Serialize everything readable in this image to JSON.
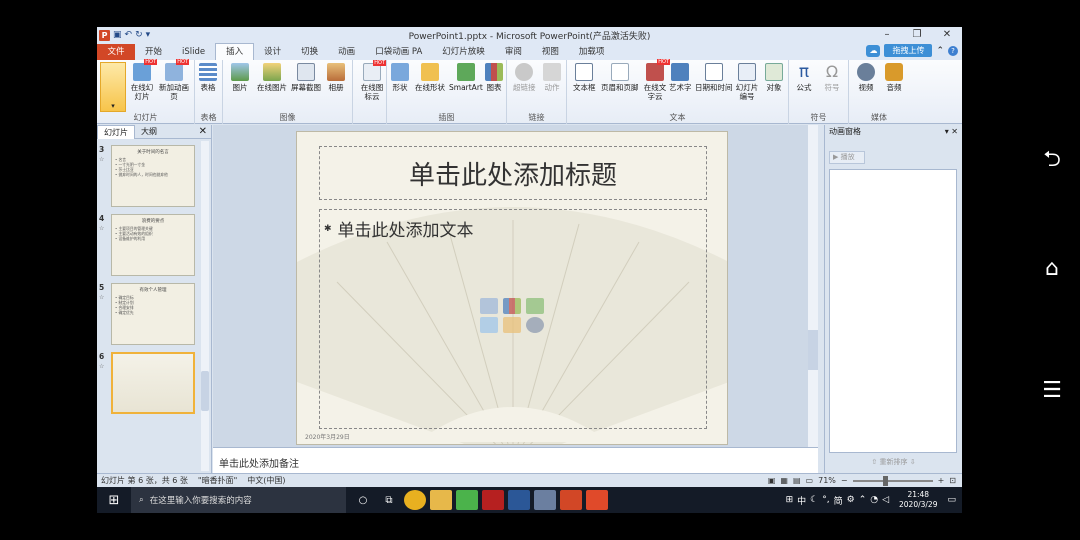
{
  "window": {
    "title": "PowerPoint1.pptx - Microsoft PowerPoint(产品激活失败)",
    "app_icon": "P"
  },
  "tabs": [
    "文件",
    "开始",
    "iSlide",
    "插入",
    "设计",
    "切换",
    "动画",
    "口袋动画 PA",
    "幻灯片放映",
    "审阅",
    "视图",
    "加载项"
  ],
  "active_tab": "插入",
  "upload_label": "拖拽上传",
  "ribbon": {
    "groups": [
      {
        "label": "幻灯片",
        "buttons": [
          "在线幻灯片",
          "新加动画页"
        ]
      },
      {
        "label": "表格",
        "buttons": [
          "表格"
        ]
      },
      {
        "label": "图像",
        "buttons": [
          "图片",
          "在线图片",
          "屏幕截图",
          "相册"
        ]
      },
      {
        "label": "",
        "buttons": [
          "在线图标云"
        ]
      },
      {
        "label": "插图",
        "buttons": [
          "形状",
          "在线形状",
          "SmartArt",
          "图表"
        ]
      },
      {
        "label": "链接",
        "buttons": [
          "超链接",
          "动作"
        ]
      },
      {
        "label": "文本",
        "buttons": [
          "文本框",
          "页眉和页脚",
          "在线文字云",
          "艺术字",
          "日期和时间",
          "幻灯片编号",
          "对象"
        ]
      },
      {
        "label": "符号",
        "buttons": [
          "公式",
          "符号"
        ]
      },
      {
        "label": "媒体",
        "buttons": [
          "视频",
          "音频"
        ]
      }
    ],
    "hot_label": "HOT"
  },
  "left_pane": {
    "tabs": [
      "幻灯片",
      "大纲"
    ],
    "slides": [
      {
        "num": "3",
        "title": "关于时间的名言",
        "lines": [
          "• 名言",
          "• 一寸光阴一寸金",
          "• 莎士比亚",
          "• 抛弃时间的人，时间也抛弃他"
        ]
      },
      {
        "num": "4",
        "title": "浪费的要点",
        "lines": [
          "• 主要项目的管理关键",
          "• 主要活动有效的组织",
          "• 设备维护的利用"
        ]
      },
      {
        "num": "5",
        "title": "有效个人管理",
        "lines": [
          "• 确定目标",
          "• 制定计划",
          "• 合理安排",
          "• 确定优先"
        ]
      },
      {
        "num": "6",
        "title": "",
        "lines": []
      }
    ]
  },
  "slide": {
    "title_placeholder": "单击此处添加标题",
    "body_placeholder": "单击此处添加文本",
    "date": "2020年3月29日"
  },
  "notes_placeholder": "单击此处添加备注",
  "anim_pane": {
    "title": "动画窗格",
    "play_label": "播放",
    "reorder_label": "重新排序"
  },
  "status": {
    "slide_info": "幻灯片 第 6 张，共 6 张",
    "theme": "\"暗香扑面\"",
    "language": "中文(中国)",
    "zoom": "71%"
  },
  "taskbar": {
    "search_placeholder": "在这里输入你要搜索的内容",
    "time": "21:48",
    "date": "2020/3/29",
    "ime": "中",
    "tray_text": "简"
  }
}
